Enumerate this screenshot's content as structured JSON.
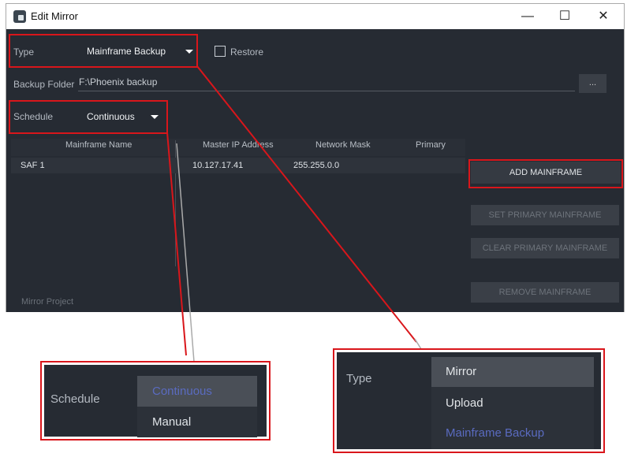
{
  "window": {
    "title": "Edit Mirror",
    "minimize": "—",
    "maximize": "☐",
    "close": "✕"
  },
  "form": {
    "type_label": "Type",
    "type_value": "Mainframe Backup",
    "restore_label": "Restore",
    "restore_checked": false,
    "backup_folder_label": "Backup Folder",
    "backup_folder_value": "F:\\Phoenix backup",
    "browse_label": "...",
    "schedule_label": "Schedule",
    "schedule_value": "Continuous"
  },
  "table": {
    "columns": [
      "Mainframe Name",
      "Master IP Address",
      "Network Mask",
      "Primary"
    ],
    "rows": [
      [
        "SAF 1",
        "10.127.17.41",
        "255.255.0.0",
        ""
      ]
    ]
  },
  "buttons": {
    "add": "ADD MAINFRAME",
    "set_primary": "SET PRIMARY MAINFRAME",
    "clear_primary": "CLEAR PRIMARY MAINFRAME",
    "remove": "REMOVE MAINFRAME"
  },
  "footer_label": "Mirror Project",
  "schedule_inset": {
    "label": "Schedule",
    "options": [
      "Continuous",
      "Manual"
    ],
    "selected": "Continuous"
  },
  "type_inset": {
    "label": "Type",
    "options": [
      "Mirror",
      "Upload",
      "Mainframe Backup"
    ],
    "selected": "Mainframe Backup"
  },
  "colors": {
    "highlight": "#d9161b",
    "selected_text": "#5a6bc0",
    "background": "#262b33"
  }
}
